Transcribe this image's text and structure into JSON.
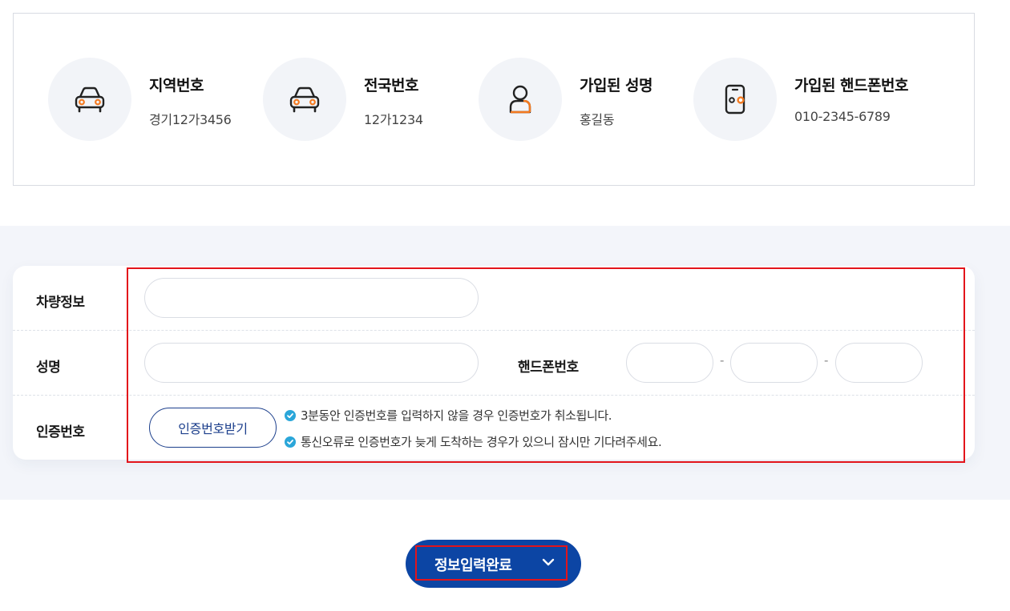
{
  "summary": {
    "items": [
      {
        "icon": "car-icon",
        "title": "지역번호",
        "value": "경기12가3456"
      },
      {
        "icon": "car-icon",
        "title": "전국번호",
        "value": "12가1234"
      },
      {
        "icon": "person-icon",
        "title": "가입된 성명",
        "value": "홍길동"
      },
      {
        "icon": "phone-icon",
        "title": "가입된 핸드폰번호",
        "value": "010-2345-6789"
      }
    ]
  },
  "form": {
    "vehicle_label": "차량정보",
    "vehicle_value": "",
    "name_label": "성명",
    "name_value": "",
    "phone_label": "핸드폰번호",
    "phone_part1": "",
    "phone_part2": "",
    "phone_part3": "",
    "phone_separator": "-",
    "verify_label": "인증번호",
    "verify_button": "인증번호받기",
    "notices": [
      "3분동안 인증번호를 입력하지 않을 경우 인증번호가 취소됩니다.",
      "통신오류로 인증번호가 늦게 도착하는 경우가 있으니 잠시만 기다려주세요."
    ]
  },
  "submit": {
    "label": "정보입력완료",
    "icon": "chevron-down-icon"
  },
  "colors": {
    "accent_orange": "#f47a20",
    "primary_blue": "#0c45a4",
    "highlight_red": "#e3141b",
    "check_blue": "#2aa6d9"
  }
}
